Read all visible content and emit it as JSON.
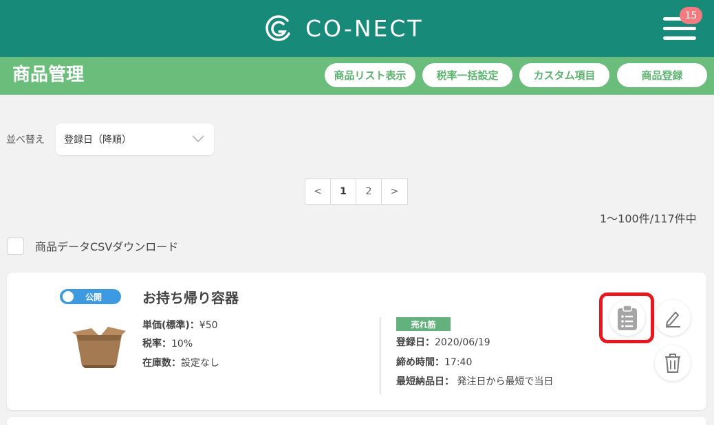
{
  "header": {
    "logo_text": "CO-NECT",
    "notification_count": "15",
    "menu_icon": "hamburger-menu-icon"
  },
  "subheader": {
    "title": "商品管理",
    "buttons": [
      "商品リスト表示",
      "税率一括設定",
      "カスタム項目",
      "商品登録"
    ]
  },
  "sort": {
    "label": "並べ替え",
    "selected": "登録日（降順）"
  },
  "pagination": {
    "prev": "<",
    "pages": [
      "1",
      "2"
    ],
    "current": "1",
    "next": ">"
  },
  "result_count": "1～100件/117件中",
  "csv": {
    "label": "商品データCSVダウンロード"
  },
  "product": {
    "status": "公開",
    "name": "お持ち帰り容器",
    "unit_price_label": "単価(標準)：",
    "unit_price": "¥50",
    "tax_label": "税率：",
    "tax": "10%",
    "stock_label": "在庫数：",
    "stock": "設定なし",
    "tag": "売れ筋",
    "registered_label": "登録日：",
    "registered": "2020/06/19",
    "deadline_label": "締め時間：",
    "deadline": "17:40",
    "delivery_label": "最短納品日：",
    "delivery": " 発注日から最短で当日"
  },
  "colors": {
    "header": "#188a7a",
    "subheader": "#6bbd7c",
    "toggle": "#3d9ae0",
    "highlight": "#e8191e"
  }
}
